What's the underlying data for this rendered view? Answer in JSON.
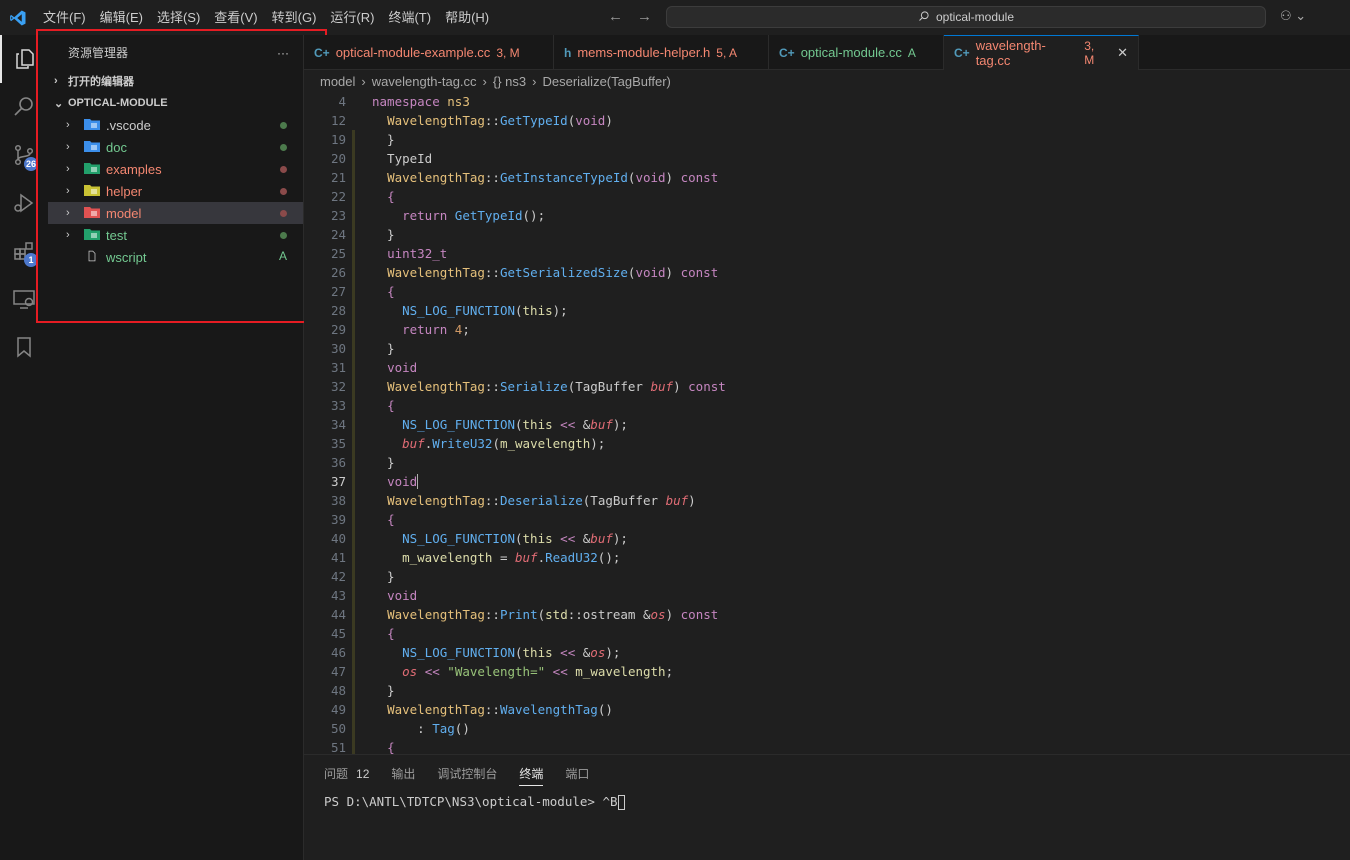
{
  "menu": [
    "文件(F)",
    "编辑(E)",
    "选择(S)",
    "查看(V)",
    "转到(G)",
    "运行(R)",
    "终端(T)",
    "帮助(H)"
  ],
  "command_center": {
    "text": "optical-module",
    "icon": "search-icon"
  },
  "activity": {
    "source_control_badge": "26",
    "extensions_badge": "1"
  },
  "explorer": {
    "title": "资源管理器",
    "more": "···",
    "open_editors": "打开的编辑器",
    "root": "OPTICAL-MODULE",
    "items": [
      {
        "name": ".vscode",
        "color": "#cccccc",
        "status": "dot-green"
      },
      {
        "name": "doc",
        "color": "#73c991",
        "status": "dot-green"
      },
      {
        "name": "examples",
        "color": "#f48771",
        "status": "dot-red"
      },
      {
        "name": "helper",
        "color": "#f48771",
        "status": "dot-red"
      },
      {
        "name": "model",
        "color": "#f48771",
        "status": "dot-red"
      },
      {
        "name": "test",
        "color": "#73c991",
        "status": "dot-green"
      },
      {
        "name": "wscript",
        "color": "#73c991",
        "status": "A"
      }
    ]
  },
  "tabs": [
    {
      "icon": "C+",
      "name": "optical-module-example.cc",
      "status": "3, M",
      "color": "#f48771"
    },
    {
      "icon": "h",
      "name": "mems-module-helper.h",
      "status": "5, A",
      "color": "#f48771"
    },
    {
      "icon": "C+",
      "name": "optical-module.cc",
      "status": "A",
      "color": "#73c991"
    },
    {
      "icon": "C+",
      "name": "wavelength-tag.cc",
      "status": "3, M",
      "color": "#f48771",
      "close": "✕"
    }
  ],
  "breadcrumb": [
    "model",
    "wavelength-tag.cc",
    "{} ns3",
    "Deserialize(TagBuffer)"
  ],
  "code": {
    "current_line": "37",
    "lines": [
      {
        "n": "4",
        "html": "<span class='kw'>namespace</span> <span class='cls'>ns3</span>"
      },
      {
        "n": "12",
        "html": "  <span class='cls'>WavelengthTag</span>::<span class='m'>GetTypeId</span>(<span class='kw'>void</span>)"
      },
      {
        "n": "19",
        "html": "  }"
      },
      {
        "n": "20",
        "html": "  TypeId"
      },
      {
        "n": "21",
        "html": "  <span class='cls'>WavelengthTag</span>::<span class='m'>GetInstanceTypeId</span>(<span class='kw'>void</span>) <span class='kw'>const</span>"
      },
      {
        "n": "22",
        "html": "  <span class='kw'>{</span>"
      },
      {
        "n": "23",
        "html": "    <span class='kw'>return</span> <span class='m'>GetTypeId</span>();"
      },
      {
        "n": "24",
        "html": "  }"
      },
      {
        "n": "25",
        "html": "  <span class='kw'>uint32_t</span>"
      },
      {
        "n": "26",
        "html": "  <span class='cls'>WavelengthTag</span>::<span class='m'>GetSerializedSize</span>(<span class='kw'>void</span>) <span class='kw'>const</span>"
      },
      {
        "n": "27",
        "html": "  <span class='kw'>{</span>"
      },
      {
        "n": "28",
        "html": "    <span class='m'>NS_LOG_FUNCTION</span>(<span class='typ'>this</span>);"
      },
      {
        "n": "29",
        "html": "    <span class='kw'>return</span> <span class='num'>4</span>;"
      },
      {
        "n": "30",
        "html": "  }"
      },
      {
        "n": "31",
        "html": "  <span class='kw'>void</span>"
      },
      {
        "n": "32",
        "html": "  <span class='cls'>WavelengthTag</span>::<span class='m'>Serialize</span>(TagBuffer <span class='par'>buf</span>) <span class='kw'>const</span>"
      },
      {
        "n": "33",
        "html": "  <span class='kw'>{</span>"
      },
      {
        "n": "34",
        "html": "    <span class='m'>NS_LOG_FUNCTION</span>(<span class='typ'>this</span> <span class='kw'>&lt;&lt;</span> &amp;<span class='par'>buf</span>);"
      },
      {
        "n": "35",
        "html": "    <span class='par'>buf</span>.<span class='m'>WriteU32</span>(<span class='typ'>m_wavelength</span>);"
      },
      {
        "n": "36",
        "html": "  }"
      },
      {
        "n": "37",
        "html": "  <span class='kw'>void</span><span style='border-left:1px solid #aeafad'></span>"
      },
      {
        "n": "38",
        "html": "  <span class='cls'>WavelengthTag</span>::<span class='m'>Deserialize</span>(TagBuffer <span class='par'>buf</span>)"
      },
      {
        "n": "39",
        "html": "  <span class='kw'>{</span>"
      },
      {
        "n": "40",
        "html": "    <span class='m'>NS_LOG_FUNCTION</span>(<span class='typ'>this</span> <span class='kw'>&lt;&lt;</span> &amp;<span class='par'>buf</span>);"
      },
      {
        "n": "41",
        "html": "    <span class='typ'>m_wavelength</span> = <span class='par'>buf</span>.<span class='m'>ReadU32</span>();"
      },
      {
        "n": "42",
        "html": "  }"
      },
      {
        "n": "43",
        "html": "  <span class='kw'>void</span>"
      },
      {
        "n": "44",
        "html": "  <span class='cls'>WavelengthTag</span>::<span class='m'>Print</span>(<span class='typ'>std</span>::ostream &amp;<span class='par'>os</span>) <span class='kw'>const</span>"
      },
      {
        "n": "45",
        "html": "  <span class='kw'>{</span>"
      },
      {
        "n": "46",
        "html": "    <span class='m'>NS_LOG_FUNCTION</span>(<span class='typ'>this</span> <span class='kw'>&lt;&lt;</span> &amp;<span class='par'>os</span>);"
      },
      {
        "n": "47",
        "html": "    <span class='par'>os</span> <span class='kw'>&lt;&lt;</span> <span class='str'>\"Wavelength=\"</span> <span class='kw'>&lt;&lt;</span> <span class='typ'>m_wavelength</span>;"
      },
      {
        "n": "48",
        "html": "  }"
      },
      {
        "n": "49",
        "html": "  <span class='cls'>WavelengthTag</span>::<span class='m'>WavelengthTag</span>()"
      },
      {
        "n": "50",
        "html": "      : <span class='m'>Tag</span>()"
      },
      {
        "n": "51",
        "html": "  <span class='kw'>{</span>"
      }
    ]
  },
  "panel": {
    "tabs": [
      "问题",
      "输出",
      "调试控制台",
      "终端",
      "端口"
    ],
    "problems_count": "12",
    "active": "终端",
    "terminal_text": "PS D:\\ANTL\\TDTCP\\NS3\\optical-module> ^B"
  }
}
